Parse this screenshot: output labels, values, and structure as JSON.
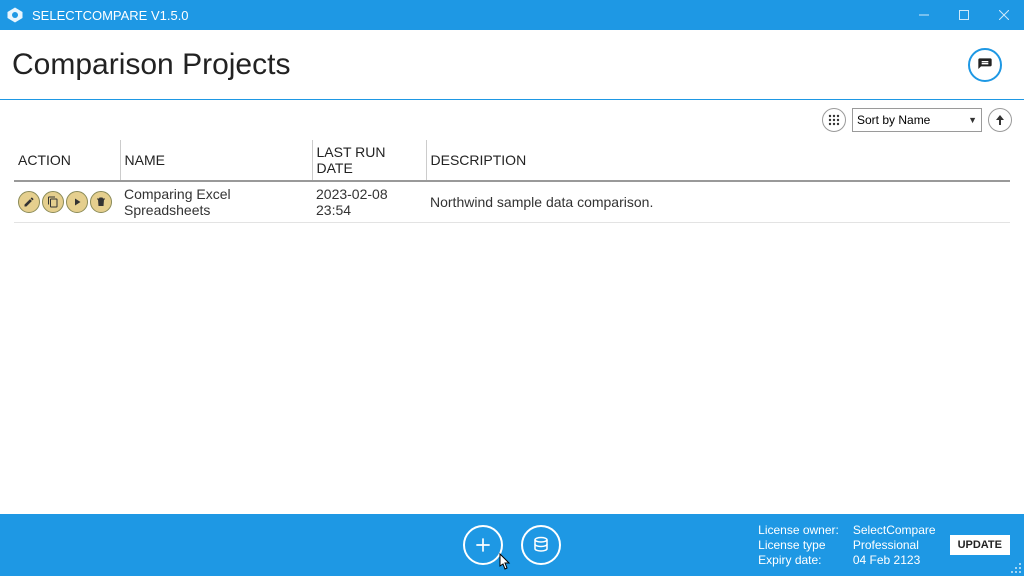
{
  "window": {
    "title": "SELECTCOMPARE V1.5.0"
  },
  "header": {
    "title": "Comparison Projects"
  },
  "toolbar": {
    "sort_label": "Sort by Name"
  },
  "table": {
    "columns": {
      "action": "ACTION",
      "name": "NAME",
      "last_run": "LAST RUN DATE",
      "description": "DESCRIPTION"
    },
    "rows": [
      {
        "name": "Comparing Excel Spreadsheets",
        "last_run": "2023-02-08 23:54",
        "description": "Northwind sample data comparison."
      }
    ]
  },
  "footer": {
    "license_owner_label": "License owner:",
    "license_owner_value": "SelectCompare",
    "license_type_label": "License type",
    "license_type_value": "Professional",
    "expiry_label": "Expiry date:",
    "expiry_value": "04 Feb 2123",
    "update_label": "UPDATE"
  }
}
